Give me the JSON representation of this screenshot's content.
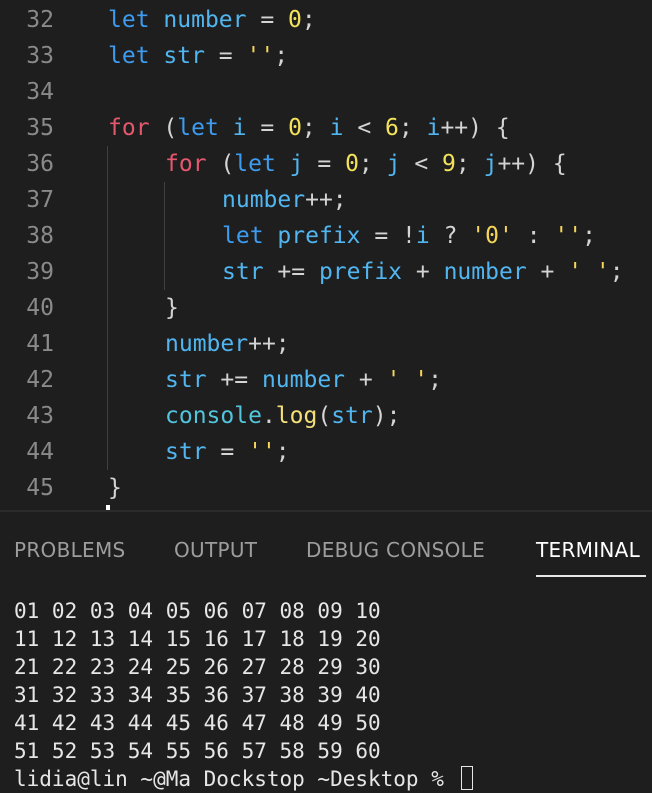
{
  "editor": {
    "lines": [
      {
        "n": "32",
        "indent": 0,
        "tokens": [
          {
            "t": "let",
            "c": "kw"
          },
          {
            "t": " "
          },
          {
            "t": "number",
            "c": "var"
          },
          {
            "t": " = ",
            "c": "op"
          },
          {
            "t": "0",
            "c": "num"
          },
          {
            "t": ";",
            "c": "op"
          }
        ]
      },
      {
        "n": "33",
        "indent": 0,
        "tokens": [
          {
            "t": "let",
            "c": "kw"
          },
          {
            "t": " "
          },
          {
            "t": "str",
            "c": "var"
          },
          {
            "t": " = ",
            "c": "op"
          },
          {
            "t": "''",
            "c": "str"
          },
          {
            "t": ";",
            "c": "op"
          }
        ]
      },
      {
        "n": "34",
        "indent": 0,
        "tokens": []
      },
      {
        "n": "35",
        "indent": 0,
        "tokens": [
          {
            "t": "for",
            "c": "ctrl"
          },
          {
            "t": " (",
            "c": "op"
          },
          {
            "t": "let",
            "c": "kw"
          },
          {
            "t": " "
          },
          {
            "t": "i",
            "c": "var"
          },
          {
            "t": " = ",
            "c": "op"
          },
          {
            "t": "0",
            "c": "num"
          },
          {
            "t": "; ",
            "c": "op"
          },
          {
            "t": "i",
            "c": "var"
          },
          {
            "t": " < ",
            "c": "op"
          },
          {
            "t": "6",
            "c": "num"
          },
          {
            "t": "; ",
            "c": "op"
          },
          {
            "t": "i",
            "c": "var"
          },
          {
            "t": "++) {",
            "c": "op"
          }
        ]
      },
      {
        "n": "36",
        "indent": 1,
        "tokens": [
          {
            "t": "for",
            "c": "ctrl"
          },
          {
            "t": " (",
            "c": "op"
          },
          {
            "t": "let",
            "c": "kw"
          },
          {
            "t": " "
          },
          {
            "t": "j",
            "c": "var"
          },
          {
            "t": " = ",
            "c": "op"
          },
          {
            "t": "0",
            "c": "num"
          },
          {
            "t": "; ",
            "c": "op"
          },
          {
            "t": "j",
            "c": "var"
          },
          {
            "t": " < ",
            "c": "op"
          },
          {
            "t": "9",
            "c": "num"
          },
          {
            "t": "; ",
            "c": "op"
          },
          {
            "t": "j",
            "c": "var"
          },
          {
            "t": "++) {",
            "c": "op"
          }
        ]
      },
      {
        "n": "37",
        "indent": 2,
        "tokens": [
          {
            "t": "number",
            "c": "var"
          },
          {
            "t": "++;",
            "c": "op"
          }
        ]
      },
      {
        "n": "38",
        "indent": 2,
        "tokens": [
          {
            "t": "let",
            "c": "kw"
          },
          {
            "t": " "
          },
          {
            "t": "prefix",
            "c": "var"
          },
          {
            "t": " = !",
            "c": "op"
          },
          {
            "t": "i",
            "c": "var"
          },
          {
            "t": " ? ",
            "c": "op"
          },
          {
            "t": "'0'",
            "c": "str"
          },
          {
            "t": " : ",
            "c": "op"
          },
          {
            "t": "''",
            "c": "str"
          },
          {
            "t": ";",
            "c": "op"
          }
        ]
      },
      {
        "n": "39",
        "indent": 2,
        "tokens": [
          {
            "t": "str",
            "c": "var"
          },
          {
            "t": " += ",
            "c": "op"
          },
          {
            "t": "prefix",
            "c": "var"
          },
          {
            "t": " + ",
            "c": "op"
          },
          {
            "t": "number",
            "c": "var"
          },
          {
            "t": " + ",
            "c": "op"
          },
          {
            "t": "' '",
            "c": "str"
          },
          {
            "t": ";",
            "c": "op"
          }
        ]
      },
      {
        "n": "40",
        "indent": 1,
        "tokens": [
          {
            "t": "}",
            "c": "op"
          }
        ]
      },
      {
        "n": "41",
        "indent": 1,
        "tokens": [
          {
            "t": "number",
            "c": "var"
          },
          {
            "t": "++;",
            "c": "op"
          }
        ]
      },
      {
        "n": "42",
        "indent": 1,
        "tokens": [
          {
            "t": "str",
            "c": "var"
          },
          {
            "t": " += ",
            "c": "op"
          },
          {
            "t": "number",
            "c": "var"
          },
          {
            "t": " + ",
            "c": "op"
          },
          {
            "t": "' '",
            "c": "str"
          },
          {
            "t": ";",
            "c": "op"
          }
        ]
      },
      {
        "n": "43",
        "indent": 1,
        "tokens": [
          {
            "t": "console",
            "c": "obj"
          },
          {
            "t": ".",
            "c": "op"
          },
          {
            "t": "log",
            "c": "fn"
          },
          {
            "t": "(",
            "c": "op"
          },
          {
            "t": "str",
            "c": "var"
          },
          {
            "t": ");",
            "c": "op"
          }
        ]
      },
      {
        "n": "44",
        "indent": 1,
        "tokens": [
          {
            "t": "str",
            "c": "var"
          },
          {
            "t": " = ",
            "c": "op"
          },
          {
            "t": "''",
            "c": "str"
          },
          {
            "t": ";",
            "c": "op"
          }
        ]
      },
      {
        "n": "45",
        "indent": 0,
        "tokens": [
          {
            "t": "}",
            "c": "op"
          }
        ]
      }
    ]
  },
  "panel": {
    "tabs": [
      {
        "label": "PROBLEMS",
        "active": false
      },
      {
        "label": "OUTPUT",
        "active": false
      },
      {
        "label": "DEBUG CONSOLE",
        "active": false
      },
      {
        "label": "TERMINAL",
        "active": true
      }
    ],
    "terminal_lines": [
      "01 02 03 04 05 06 07 08 09 10",
      "11 12 13 14 15 16 17 18 19 20",
      "21 22 23 24 25 26 27 28 29 30",
      "31 32 33 34 35 36 37 38 39 40",
      "41 42 43 44 45 46 47 48 49 50",
      "51 52 53 54 55 56 57 58 59 60"
    ],
    "prompt_partial": "lidia@lin ~@Ma Dockstop ~Desktop % "
  }
}
